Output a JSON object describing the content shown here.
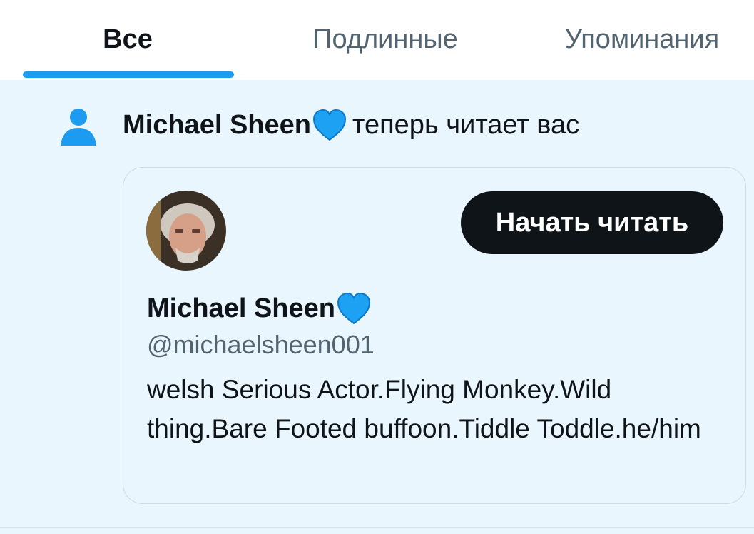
{
  "tabs": [
    {
      "label": "Все",
      "active": true
    },
    {
      "label": "Подлинные",
      "active": false
    },
    {
      "label": "Упоминания",
      "active": false
    }
  ],
  "notification": {
    "icon": "person-icon",
    "actor_name": "Michael Sheen",
    "actor_emoji": "blue-heart-icon",
    "action_text": "теперь читает вас"
  },
  "profile_card": {
    "name": "Michael Sheen",
    "handle": "@michaelsheen001",
    "follow_label": "Начать читать",
    "bio": "welsh Serious Actor.Flying Monkey.Wild thing.Bare Footed buffoon.Tiddle Toddle.he/him"
  },
  "colors": {
    "accent": "#1d9bf0",
    "notification_bg": "#eaf6fd",
    "button_bg": "#0f1419",
    "muted_text": "#536471"
  }
}
